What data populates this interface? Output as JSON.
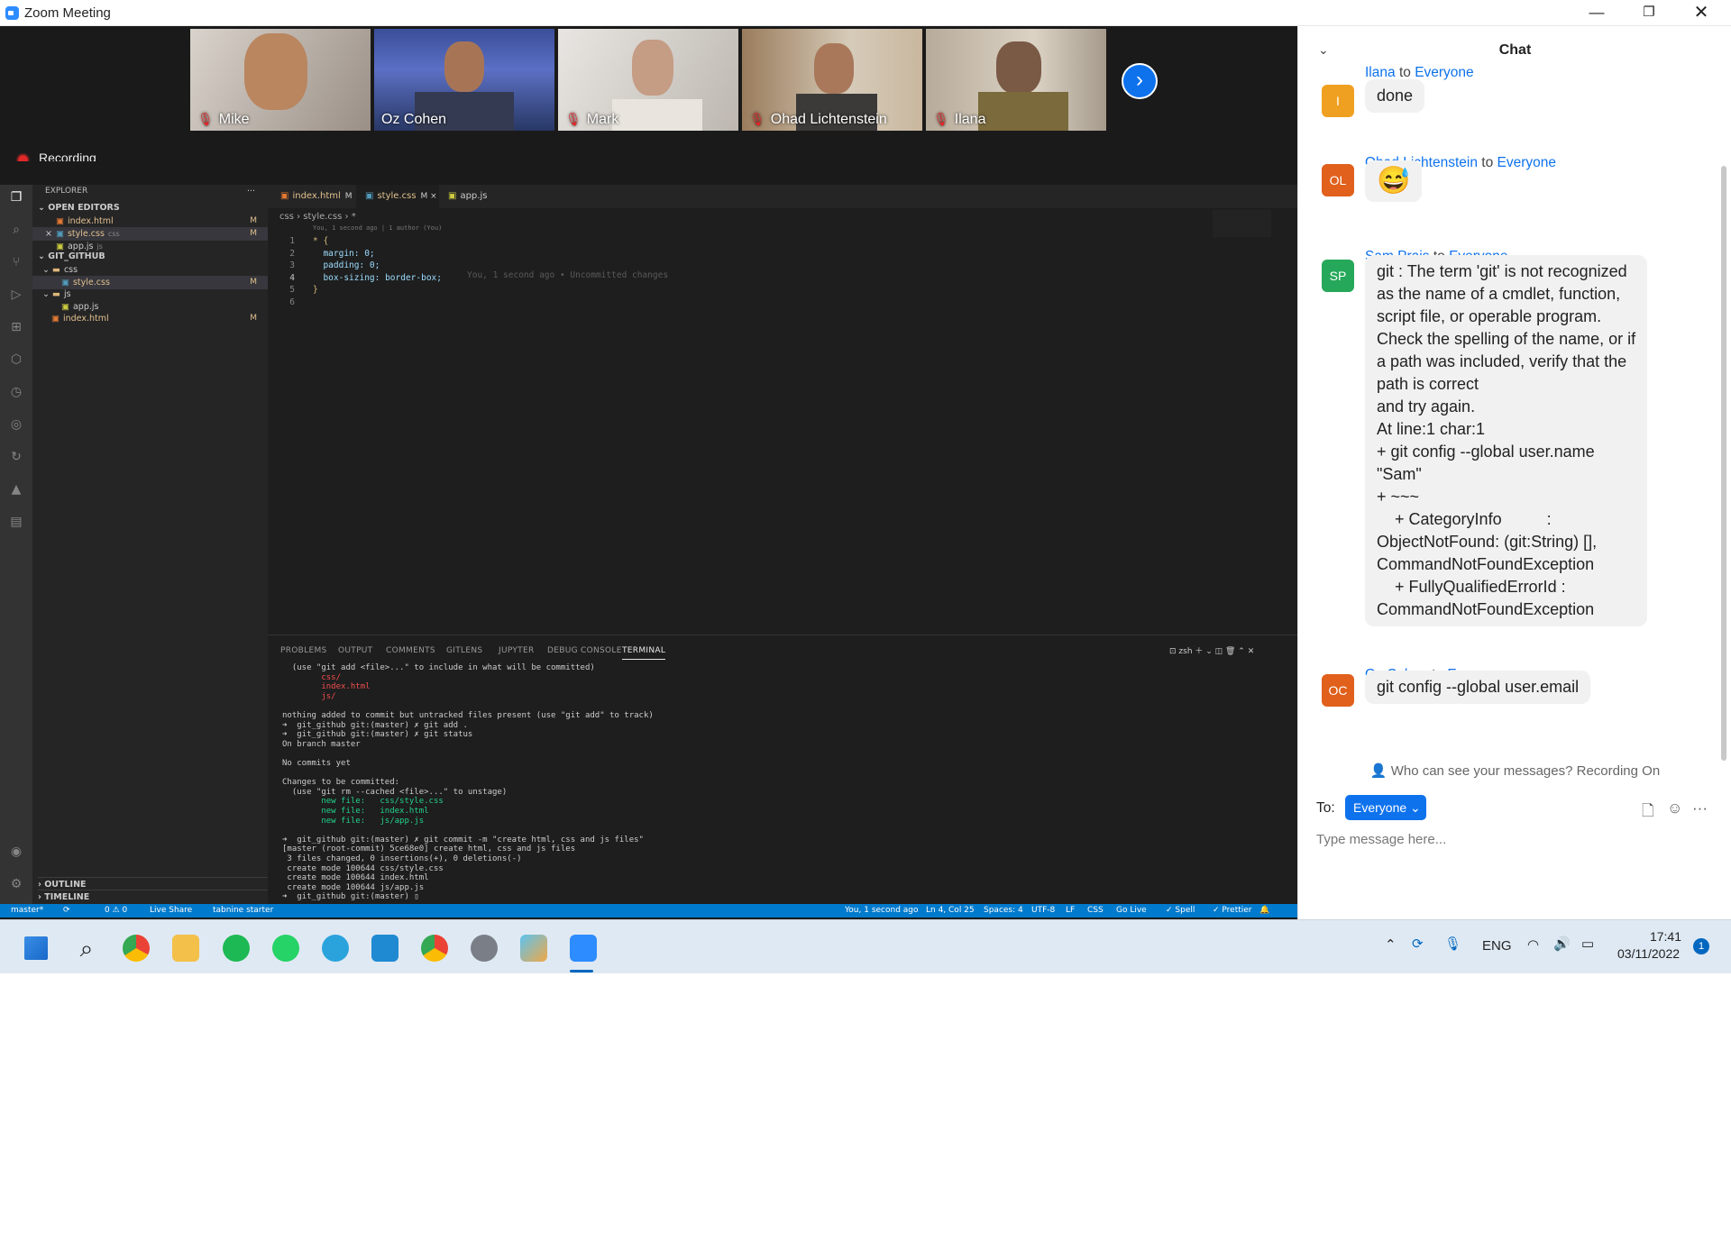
{
  "window": {
    "title": "Zoom Meeting"
  },
  "participants": [
    {
      "name": "Mike",
      "muted": true
    },
    {
      "name": "Oz Cohen",
      "muted": false
    },
    {
      "name": "Mark",
      "muted": true
    },
    {
      "name": "Ohad Lichtenstein",
      "muted": true
    },
    {
      "name": "Ilana",
      "muted": true
    }
  ],
  "recording": {
    "label": "Recording"
  },
  "vscode": {
    "explorer_title": "EXPLORER",
    "open_editors_title": "OPEN EDITORS",
    "open_editors": [
      {
        "name": "index.html",
        "flag": "M",
        "color": "#e37933",
        "close": ""
      },
      {
        "name": "style.css",
        "suffix": "css",
        "flag": "M",
        "color": "#519aba",
        "close": "×"
      },
      {
        "name": "app.js",
        "suffix": "js",
        "flag": "",
        "color": "#cbcb41",
        "close": ""
      }
    ],
    "workspace_title": "GIT_GITHUB",
    "tree": [
      {
        "name": "css",
        "type": "folder",
        "indent": 1
      },
      {
        "name": "style.css",
        "type": "file",
        "indent": 2,
        "flag": "M",
        "color": "#519aba"
      },
      {
        "name": "js",
        "type": "folder",
        "indent": 1
      },
      {
        "name": "app.js",
        "type": "file",
        "indent": 2,
        "flag": "",
        "color": "#cbcb41"
      },
      {
        "name": "index.html",
        "type": "file",
        "indent": 1,
        "flag": "M",
        "color": "#e37933"
      }
    ],
    "outline": "OUTLINE",
    "timeline": "TIMELINE",
    "tabs": [
      {
        "label": "index.html",
        "flag": "M",
        "color": "#e37933"
      },
      {
        "label": "style.css",
        "flag": "M ×",
        "color": "#519aba"
      },
      {
        "label": "app.js",
        "flag": "",
        "color": "#cbcb41"
      }
    ],
    "breadcrumb": "css  ›  style.css  ›  *",
    "blame_top": "You, 1 second ago | 1 author (You)",
    "code": [
      {
        "n": "1",
        "t": "* {"
      },
      {
        "n": "2",
        "t": "  margin: 0;"
      },
      {
        "n": "3",
        "t": "  padding: 0;"
      },
      {
        "n": "4",
        "t": "  box-sizing: border-box;"
      },
      {
        "n": "5",
        "t": "}"
      },
      {
        "n": "6",
        "t": ""
      }
    ],
    "inline_blame": "You, 1 second ago • Uncommitted changes",
    "panel_tabs": [
      "PROBLEMS",
      "OUTPUT",
      "COMMENTS",
      "GITLENS",
      "JUPYTER",
      "DEBUG CONSOLE",
      "TERMINAL"
    ],
    "terminal_shell": "zsh",
    "terminal": [
      {
        "t": "  (use \"git add <file>...\" to include in what will be committed)",
        "c": "#ccc"
      },
      {
        "t": "        css/",
        "c": "#f14c4c"
      },
      {
        "t": "        index.html",
        "c": "#f14c4c"
      },
      {
        "t": "        js/",
        "c": "#f14c4c"
      },
      {
        "t": "",
        "c": "#ccc"
      },
      {
        "t": "nothing added to commit but untracked files present (use \"git add\" to track)",
        "c": "#ccc"
      },
      {
        "t": "➜  git_github git:(master) ✗ git add .",
        "c": "#ccc"
      },
      {
        "t": "➜  git_github git:(master) ✗ git status",
        "c": "#ccc"
      },
      {
        "t": "On branch master",
        "c": "#ccc"
      },
      {
        "t": "",
        "c": "#ccc"
      },
      {
        "t": "No commits yet",
        "c": "#ccc"
      },
      {
        "t": "",
        "c": "#ccc"
      },
      {
        "t": "Changes to be committed:",
        "c": "#ccc"
      },
      {
        "t": "  (use \"git rm --cached <file>...\" to unstage)",
        "c": "#ccc"
      },
      {
        "t": "        new file:   css/style.css",
        "c": "#23d18b"
      },
      {
        "t": "        new file:   index.html",
        "c": "#23d18b"
      },
      {
        "t": "        new file:   js/app.js",
        "c": "#23d18b"
      },
      {
        "t": "",
        "c": "#ccc"
      },
      {
        "t": "➜  git_github git:(master) ✗ git commit -m \"create html, css and js files\"",
        "c": "#ccc"
      },
      {
        "t": "[master (root-commit) 5ce68e0] create html, css and js files",
        "c": "#ccc"
      },
      {
        "t": " 3 files changed, 0 insertions(+), 0 deletions(-)",
        "c": "#ccc"
      },
      {
        "t": " create mode 100644 css/style.css",
        "c": "#ccc"
      },
      {
        "t": " create mode 100644 index.html",
        "c": "#ccc"
      },
      {
        "t": " create mode 100644 js/app.js",
        "c": "#ccc"
      },
      {
        "t": "➜  git_github git:(master) ▯",
        "c": "#ccc"
      }
    ],
    "status_left": [
      "master*",
      "⟳",
      "0 ⚠ 0",
      "Live Share",
      "tabnine starter"
    ],
    "status_right": [
      "You, 1 second ago",
      "Ln 4, Col 25",
      "Spaces: 4",
      "UTF-8",
      "LF",
      "CSS",
      "Go Live",
      "✓ Spell",
      "✓ Prettier"
    ]
  },
  "chat": {
    "title": "Chat",
    "messages": [
      {
        "sender": "Ilana",
        "to": "to",
        "recipient": "Everyone",
        "initials": "I",
        "avatar_color": "#f0a020",
        "text": "done"
      },
      {
        "sender": "Ohad Lichtenstein",
        "to": "to",
        "recipient": "Everyone",
        "initials": "OL",
        "avatar_color": "#e0601c",
        "text": "😅"
      },
      {
        "sender": "Sam Prais",
        "to": "to",
        "recipient": "Everyone",
        "initials": "SP",
        "avatar_color": "#26a85a",
        "lines": [
          "git : The term 'git' is not recognized",
          "as the name of a cmdlet, function,",
          "script file, or operable program.",
          "Check the spelling of the name, or if",
          "a path was included, verify that the",
          "path is correct",
          "and try again.",
          "At line:1 char:1",
          "+ git config --global user.name",
          "\"Sam\"",
          "+ ~~~",
          "    + CategoryInfo          :",
          "ObjectNotFound: (git:String) [],",
          "CommandNotFoundException",
          "    + FullyQualifiedErrorId :",
          "CommandNotFoundException"
        ]
      },
      {
        "sender": "Oz Cohen",
        "to": "to",
        "recipient": "Everyone",
        "initials": "OC",
        "avatar_color": "#e0601c",
        "text": "git config --global user.email"
      }
    ],
    "who_can_see": "Who can see your messages? Recording On",
    "to_label": "To:",
    "recipient_select": "Everyone",
    "input_placeholder": "Type message here..."
  },
  "taskbar": {
    "apps": [
      "start",
      "search",
      "chrome",
      "file-explorer",
      "spotify",
      "whatsapp",
      "telegram",
      "vscode",
      "chrome-profile",
      "settings",
      "paint",
      "zoom"
    ],
    "lang": "ENG",
    "time": "17:41",
    "date": "03/11/2022",
    "notification_count": "1"
  }
}
